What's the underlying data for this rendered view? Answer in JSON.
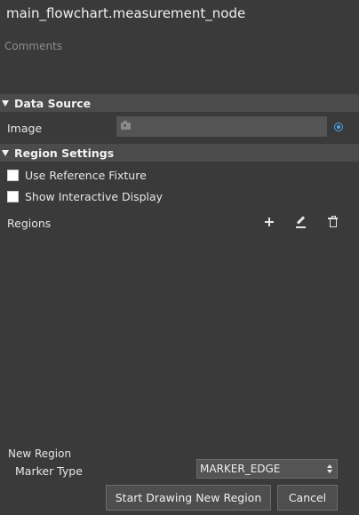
{
  "header": {
    "title": "main_flowchart.measurement_node",
    "comments_placeholder": "Comments"
  },
  "data_source": {
    "heading": "Data Source",
    "image_label": "Image",
    "image_value": "",
    "image_field_icon": "camera-icon",
    "link_icon": "radio-target-icon"
  },
  "region_settings": {
    "heading": "Region Settings",
    "use_reference_fixture": {
      "label": "Use Reference Fixture",
      "checked": false
    },
    "show_interactive_display": {
      "label": "Show Interactive Display",
      "checked": false
    },
    "regions_label": "Regions",
    "region_icons": [
      "plus-icon",
      "edit-icon",
      "trash-icon"
    ]
  },
  "new_region": {
    "heading": "New Region",
    "marker_type_label": "Marker Type",
    "marker_type_value": "MARKER_EDGE",
    "start_button": "Start Drawing New Region",
    "cancel_button": "Cancel"
  },
  "colors": {
    "background": "#3a3a3a",
    "section_header": "#4b4b4b",
    "field": "#545454",
    "accent": "#4aa3e8"
  }
}
